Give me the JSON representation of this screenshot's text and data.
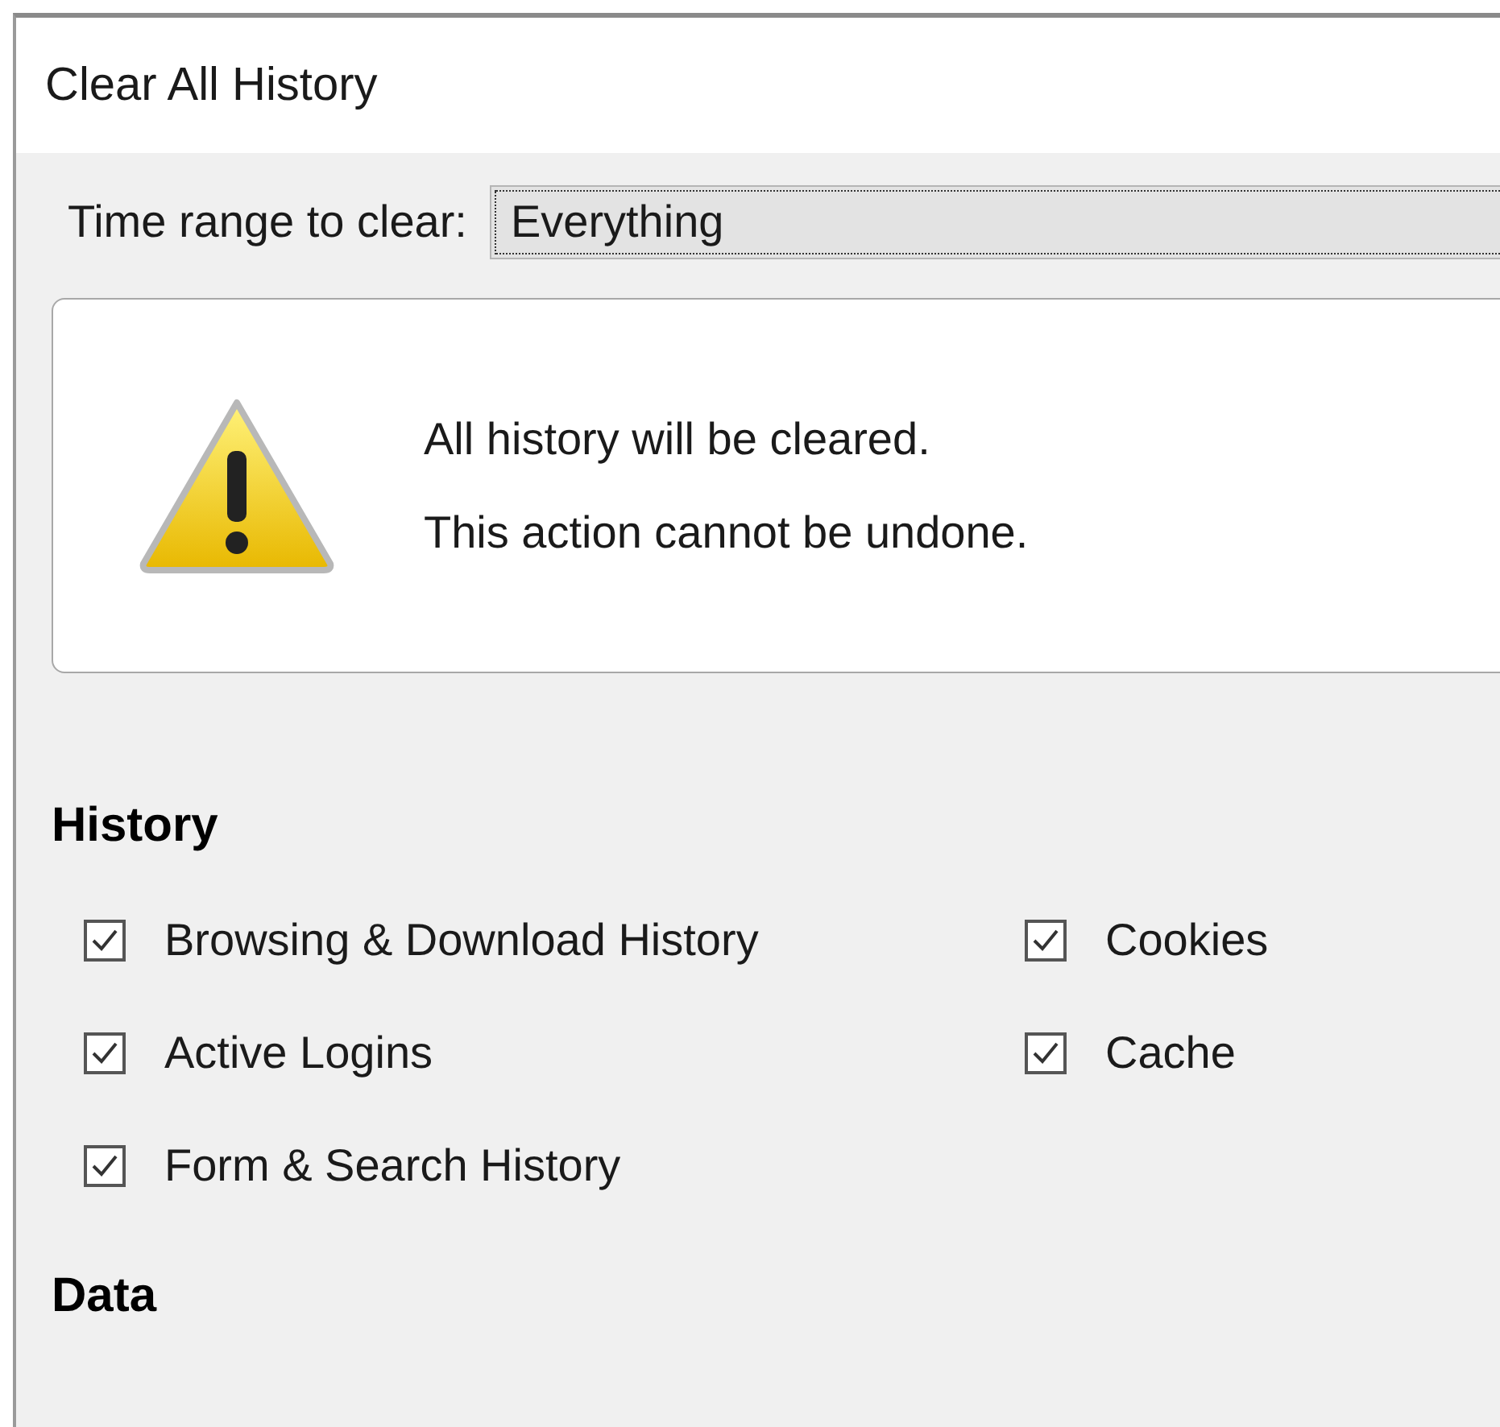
{
  "window": {
    "title": "Clear All History"
  },
  "time_range": {
    "label": "Time range to clear:",
    "value": "Everything"
  },
  "warning": {
    "lines": [
      "All history will be cleared.",
      "This action cannot be undone."
    ]
  },
  "sections": [
    {
      "heading": "History",
      "options": [
        {
          "label": "Browsing & Download History",
          "checked": true
        },
        {
          "label": "Cookies",
          "checked": true
        },
        {
          "label": "Active Logins",
          "checked": true
        },
        {
          "label": "Cache",
          "checked": true
        },
        {
          "label": "Form & Search History",
          "checked": true
        }
      ]
    },
    {
      "heading": "Data"
    }
  ]
}
